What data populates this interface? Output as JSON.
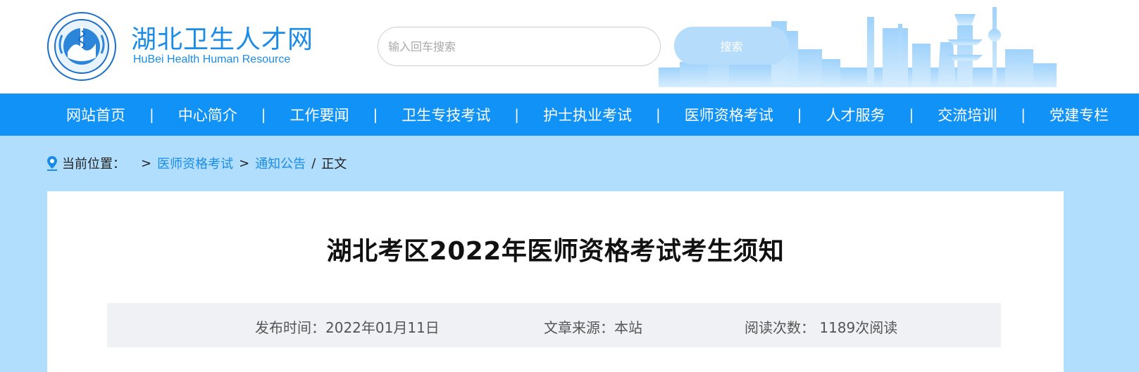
{
  "header": {
    "site_title": "湖北卫生人才网",
    "site_subtitle": "HuBei Health Human Resource",
    "logo_icon": "hubei-health-commission-emblem-icon",
    "search": {
      "placeholder": "输入回车搜索",
      "value": "",
      "button_label": "搜索"
    }
  },
  "nav": {
    "items": [
      {
        "label": "网站首页"
      },
      {
        "label": "中心简介"
      },
      {
        "label": "工作要闻"
      },
      {
        "label": "卫生专技考试"
      },
      {
        "label": "护士执业考试"
      },
      {
        "label": "医师资格考试"
      },
      {
        "label": "人才服务"
      },
      {
        "label": "交流培训"
      },
      {
        "label": "党建专栏"
      }
    ],
    "separator": "|"
  },
  "breadcrumb": {
    "label": "当前位置：",
    "sep": ">",
    "links": [
      "医师资格考试",
      "通知公告"
    ],
    "current_sep": "/",
    "current": "正文"
  },
  "article": {
    "title": "湖北考区2022年医师资格考试考生须知",
    "meta": {
      "publish": "发布时间：2022年01月11日",
      "source": "文章来源：本站",
      "views": "阅读次数： 1189次阅读"
    }
  },
  "colors": {
    "brand_blue": "#1a8ce8",
    "nav_bg": "#1092f7",
    "page_bg": "#b1defd",
    "search_button": "#b6dcfb",
    "meta_bg": "#eff1f4"
  }
}
